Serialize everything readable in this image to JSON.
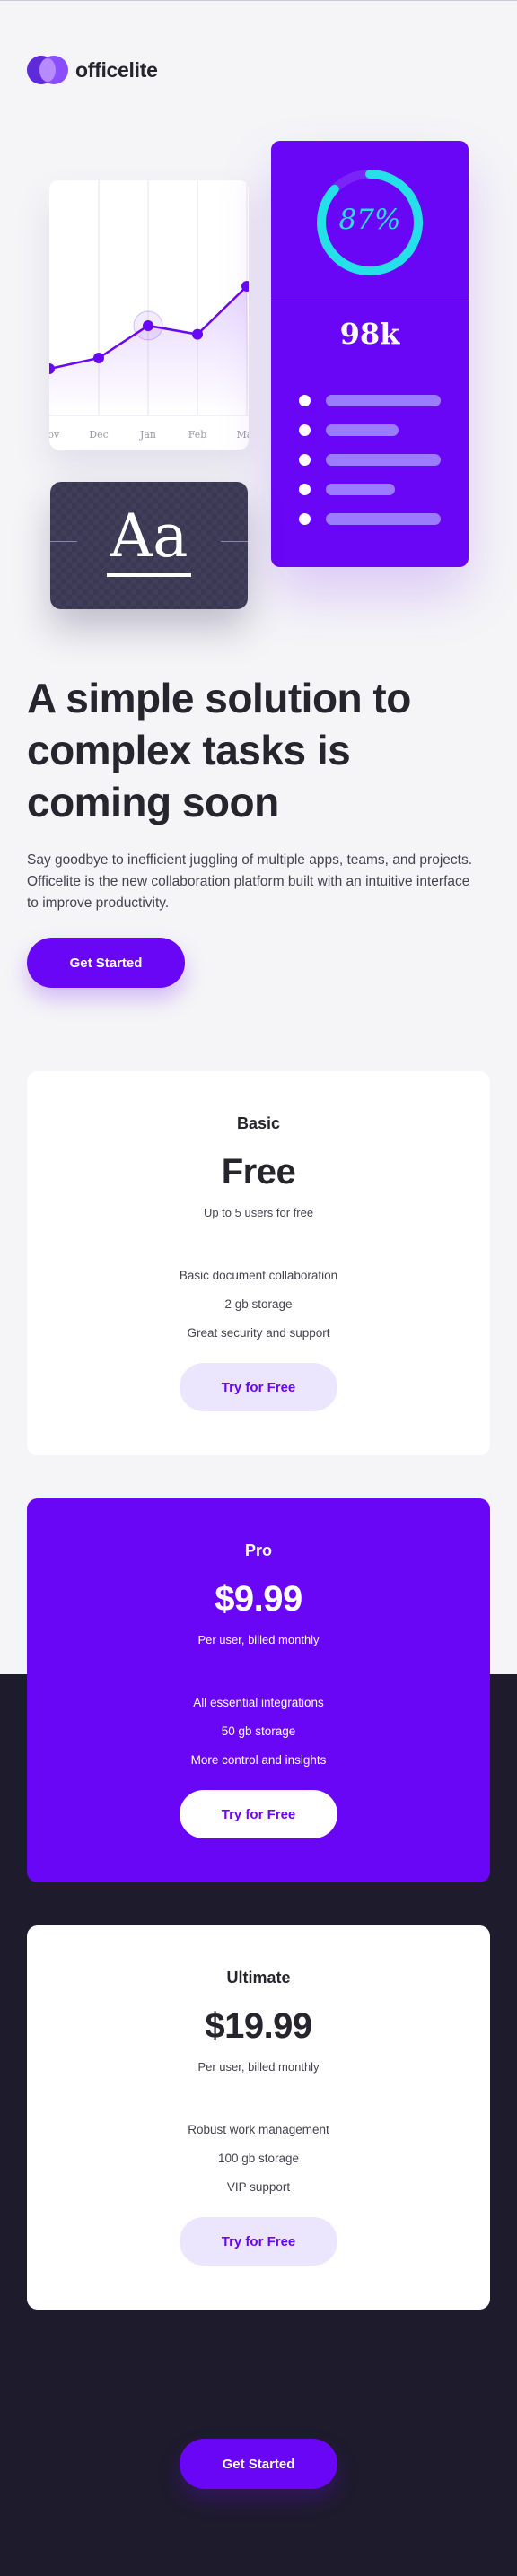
{
  "brand": {
    "name": "officelite"
  },
  "illustration": {
    "chart_months": [
      "Nov",
      "Dec",
      "Jan",
      "Feb",
      "Mar"
    ],
    "chart_values": [
      40,
      55,
      100,
      88,
      155
    ],
    "ring_percent": 87,
    "ring_label": "87%",
    "big_stat": "98k",
    "list_bar_fill": [
      1.0,
      0.63,
      1.0,
      0.6,
      1.0
    ],
    "type_sample": "Aa"
  },
  "hero": {
    "title": "A simple solution to complex tasks is coming soon",
    "subtitle": "Say goodbye to inefficient juggling of multiple apps, teams, and projects. Officelite is the new collaboration platform built with an intuitive interface to improve productivity.",
    "cta_label": "Get Started"
  },
  "plans": [
    {
      "name": "Basic",
      "price": "Free",
      "description": "Up to 5 users for free",
      "features": [
        "Basic document collaboration",
        "2 gb storage",
        "Great security and support"
      ],
      "cta_label": "Try for Free"
    },
    {
      "name": "Pro",
      "price": "$9.99",
      "description": "Per user, billed monthly",
      "features": [
        "All essential integrations",
        "50 gb storage",
        "More control and insights"
      ],
      "cta_label": "Try for Free"
    },
    {
      "name": "Ultimate",
      "price": "$19.99",
      "description": "Per user, billed monthly",
      "features": [
        "Robust work management",
        "100 gb storage",
        "VIP support"
      ],
      "cta_label": "Try for Free"
    }
  ],
  "footer": {
    "cta_label": "Get Started"
  },
  "colors": {
    "accent": "#6a06f6",
    "dark": "#1e1b2c",
    "text": "#26252e",
    "ring": "#25e0e8",
    "light_button": "#ebe6fd"
  }
}
